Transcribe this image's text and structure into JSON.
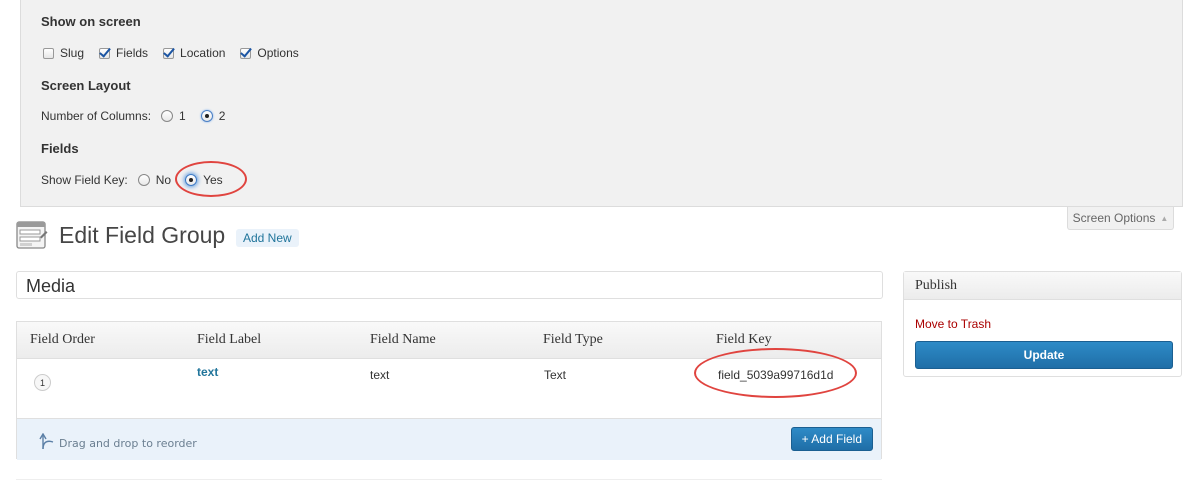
{
  "screen_options": {
    "show_on_screen": {
      "heading": "Show on screen",
      "items": [
        {
          "label": "Slug",
          "checked": false
        },
        {
          "label": "Fields",
          "checked": true
        },
        {
          "label": "Location",
          "checked": true
        },
        {
          "label": "Options",
          "checked": true
        }
      ]
    },
    "screen_layout": {
      "heading": "Screen Layout",
      "label": "Number of Columns:",
      "options": [
        {
          "label": "1",
          "selected": false
        },
        {
          "label": "2",
          "selected": true
        }
      ]
    },
    "fields": {
      "heading": "Fields",
      "label": "Show Field Key:",
      "options": [
        {
          "label": "No",
          "selected": false
        },
        {
          "label": "Yes",
          "selected": true
        }
      ]
    },
    "tab_label": "Screen Options"
  },
  "header": {
    "title": "Edit Field Group",
    "add_new": "Add New"
  },
  "title_input": {
    "value": "Media"
  },
  "fields_table": {
    "columns": [
      "Field Order",
      "Field Label",
      "Field Name",
      "Field Type",
      "Field Key"
    ],
    "rows": [
      {
        "order": "1",
        "label": "text",
        "name": "text",
        "type": "Text",
        "key": "field_5039a99716d1d"
      }
    ],
    "drag_hint": "Drag and drop to reorder",
    "add_field": "+ Add Field"
  },
  "publish": {
    "title": "Publish",
    "trash": "Move to Trash",
    "update": "Update"
  },
  "colors": {
    "accent": "#21759b",
    "button": "#2477ae",
    "annotation": "#e0443f",
    "trash": "#aa0000"
  }
}
